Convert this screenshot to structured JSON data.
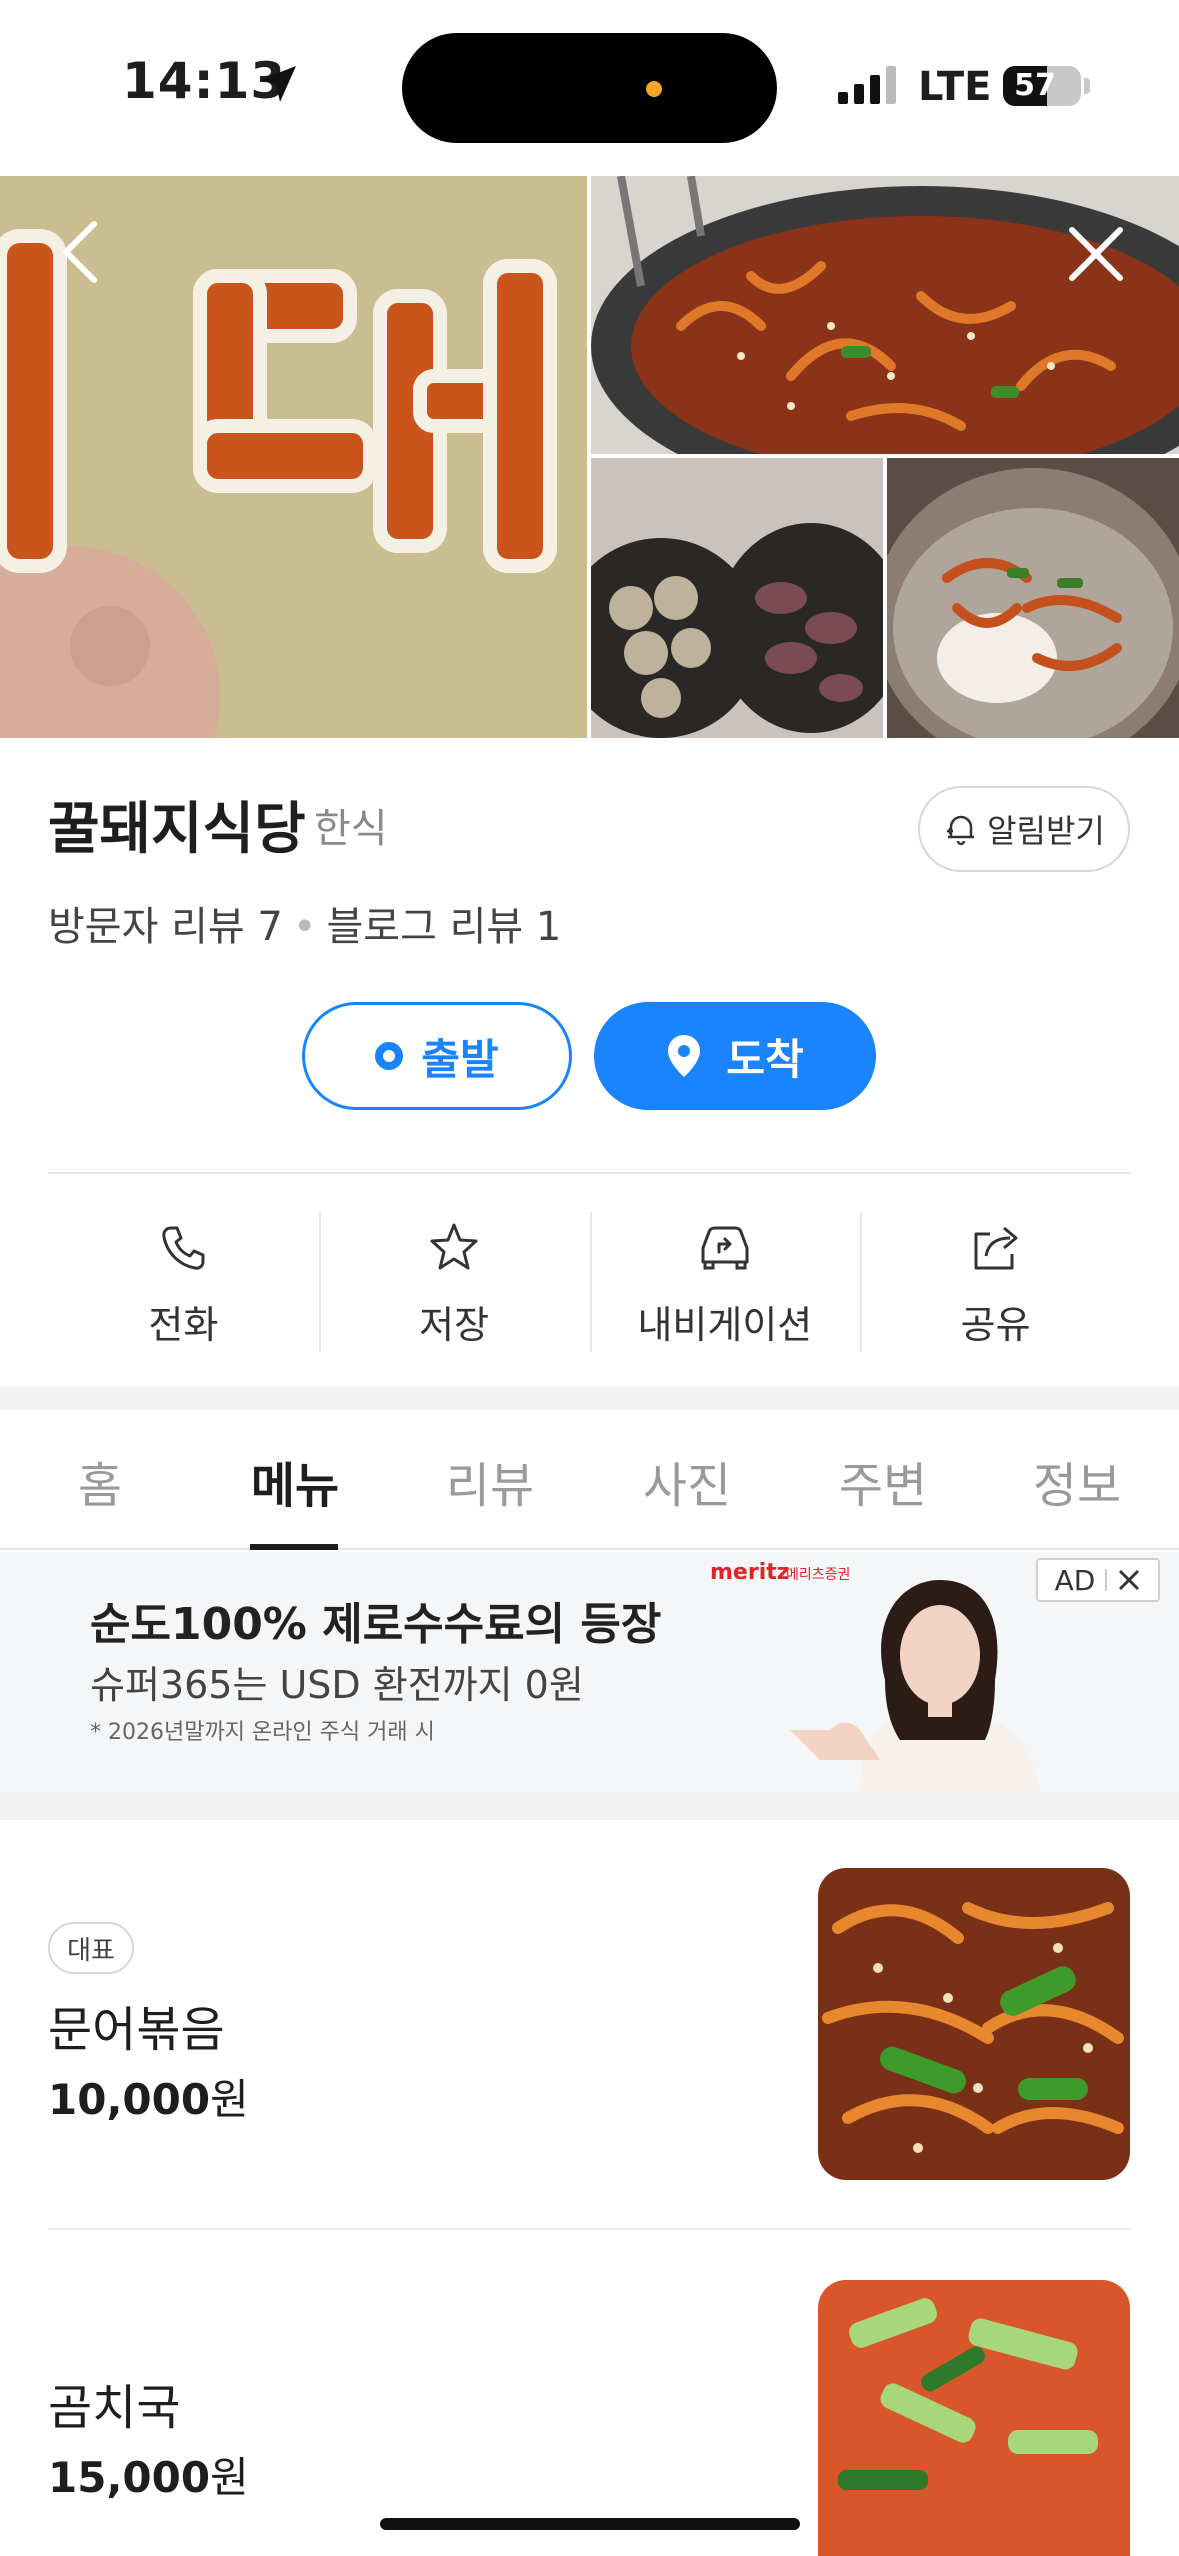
{
  "status_bar": {
    "time": "14:13",
    "network": "LTE",
    "battery": "57",
    "battery_level_percent": 57
  },
  "place": {
    "name": "꿀돼지식당",
    "category": "한식",
    "notify_label": "알림받기",
    "visitor_reviews": "방문자 리뷰 7",
    "blog_reviews": "블로그 리뷰 1"
  },
  "route": {
    "depart_label": "출발",
    "arrive_label": "도착"
  },
  "actions": [
    {
      "label": "전화",
      "icon": "phone-icon"
    },
    {
      "label": "저장",
      "icon": "star-icon"
    },
    {
      "label": "내비게이션",
      "icon": "car-navigation-icon"
    },
    {
      "label": "공유",
      "icon": "share-icon"
    }
  ],
  "tabs": [
    "홈",
    "메뉴",
    "리뷰",
    "사진",
    "주변",
    "정보"
  ],
  "active_tab": "메뉴",
  "ad": {
    "headline": "순도100% 제로수수료의 등장",
    "subline": "슈퍼365는 USD 환전까지 0원",
    "footnote": "* 2026년말까지 온라인 주식 거래 시",
    "brand": "meritz",
    "brand_sub": "메리츠증권",
    "badge": "AD"
  },
  "menu": [
    {
      "badge": "대표",
      "name": "문어볶음",
      "price": "10,000",
      "currency": "원"
    },
    {
      "name": "곰치국",
      "price": "15,000",
      "currency": "원"
    }
  ],
  "colors": {
    "accent": "#1a84ff",
    "ad_brand": "#e0242b"
  }
}
